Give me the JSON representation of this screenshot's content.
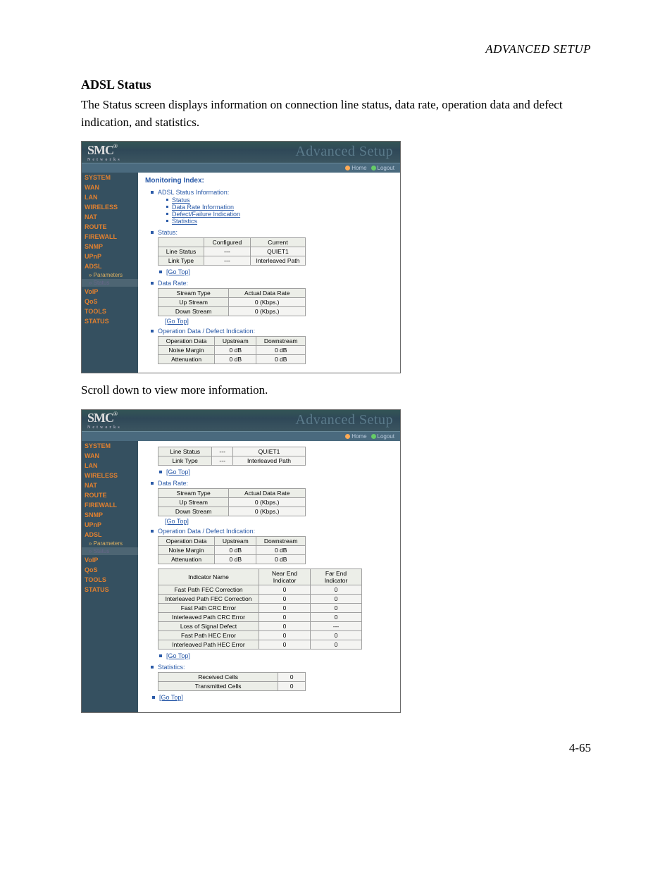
{
  "doc": {
    "header": "ADVANCED SETUP",
    "title": "ADSL Status",
    "para1": "The Status screen displays information on connection line status, data rate, operation data and defect indication, and statistics.",
    "para2": "Scroll down to view more information.",
    "pagenum": "4-65"
  },
  "common": {
    "logo": "SMC",
    "logo_sub": "Networks",
    "tagline": "Advanced Setup",
    "tab_home": "Home",
    "tab_logout": "Logout",
    "gotop": "[Go Top]"
  },
  "sidebar": [
    {
      "label": "SYSTEM"
    },
    {
      "label": "WAN"
    },
    {
      "label": "LAN"
    },
    {
      "label": "WIRELESS"
    },
    {
      "label": "NAT"
    },
    {
      "label": "ROUTE"
    },
    {
      "label": "FIREWALL"
    },
    {
      "label": "SNMP"
    },
    {
      "label": "UPnP"
    },
    {
      "label": "ADSL"
    },
    {
      "label": "Parameters",
      "sub": true
    },
    {
      "label": "Status",
      "sub": true,
      "active": true
    },
    {
      "label": "VoIP"
    },
    {
      "label": "QoS"
    },
    {
      "label": "TOOLS"
    },
    {
      "label": "STATUS"
    }
  ],
  "s1": {
    "mon_title": "Monitoring Index:",
    "adsl_info_label": "ADSL Status Information:",
    "links": [
      "Status",
      "Data Rate Information",
      "Defect/Failure Indication",
      "Statistics"
    ],
    "status_label": "Status:",
    "status_table": {
      "h": [
        "",
        "Configured",
        "Current"
      ],
      "rows": [
        [
          "Line Status",
          "---",
          "QUIET1"
        ],
        [
          "Link Type",
          "---",
          "Interleaved Path"
        ]
      ]
    },
    "datarate_label": "Data Rate:",
    "datarate_table": {
      "h": [
        "Stream Type",
        "Actual Data Rate"
      ],
      "rows": [
        [
          "Up Stream",
          "0 (Kbps.)"
        ],
        [
          "Down Stream",
          "0 (Kbps.)"
        ]
      ]
    },
    "op_label": "Operation Data / Defect Indication:",
    "op_table": {
      "h": [
        "Operation Data",
        "Upstream",
        "Downstream"
      ],
      "rows": [
        [
          "Noise Margin",
          "0 dB",
          "0 dB"
        ],
        [
          "Attenuation",
          "0 dB",
          "0 dB"
        ]
      ]
    }
  },
  "s2": {
    "status_rows": [
      [
        "Line Status",
        "---",
        "QUIET1"
      ],
      [
        "Link Type",
        "---",
        "Interleaved Path"
      ]
    ],
    "datarate_label": "Data Rate:",
    "datarate_table": {
      "h": [
        "Stream Type",
        "Actual Data Rate"
      ],
      "rows": [
        [
          "Up Stream",
          "0 (Kbps.)"
        ],
        [
          "Down Stream",
          "0 (Kbps.)"
        ]
      ]
    },
    "op_label": "Operation Data / Defect Indication:",
    "op_table": {
      "h": [
        "Operation Data",
        "Upstream",
        "Downstream"
      ],
      "rows": [
        [
          "Noise Margin",
          "0 dB",
          "0 dB"
        ],
        [
          "Attenuation",
          "0 dB",
          "0 dB"
        ]
      ]
    },
    "ind_table": {
      "h": [
        "Indicator Name",
        "Near End Indicator",
        "Far End Indicator"
      ],
      "rows": [
        [
          "Fast Path FEC Correction",
          "0",
          "0"
        ],
        [
          "Interleaved Path FEC Correction",
          "0",
          "0"
        ],
        [
          "Fast Path CRC Error",
          "0",
          "0"
        ],
        [
          "Interleaved Path CRC Error",
          "0",
          "0"
        ],
        [
          "Loss of Signal Defect",
          "0",
          "---"
        ],
        [
          "Fast Path HEC Error",
          "0",
          "0"
        ],
        [
          "Interleaved Path HEC Error",
          "0",
          "0"
        ]
      ]
    },
    "stats_label": "Statistics:",
    "stats_rows": [
      [
        "Received Cells",
        "0"
      ],
      [
        "Transmitted Cells",
        "0"
      ]
    ]
  }
}
